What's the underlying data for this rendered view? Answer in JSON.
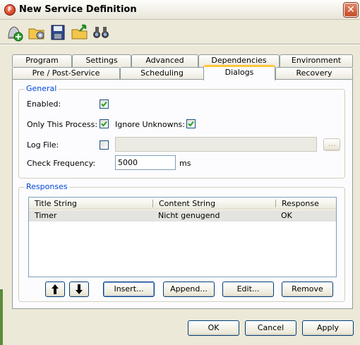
{
  "window": {
    "title": "New Service Definition",
    "close_symbol": "✕",
    "app_icon_letter": "F"
  },
  "toolbar": {
    "buttons": [
      {
        "name": "new-service-icon"
      },
      {
        "name": "open-folder-gear-icon"
      },
      {
        "name": "save-icon"
      },
      {
        "name": "open-folder-icon"
      },
      {
        "name": "find-binoculars-icon"
      }
    ]
  },
  "tabs": {
    "row_back": [
      "Program",
      "Settings",
      "Advanced",
      "Dependencies",
      "Environment"
    ],
    "row_front": [
      "Pre / Post-Service",
      "Scheduling",
      "Dialogs",
      "Recovery"
    ],
    "active": "Dialogs"
  },
  "general": {
    "legend": "General",
    "enabled_label": "Enabled:",
    "enabled_checked": true,
    "only_this_process_label": "Only This Process:",
    "only_this_process_checked": true,
    "ignore_unknowns_label": "Ignore Unknowns:",
    "ignore_unknowns_checked": true,
    "log_file_label": "Log File:",
    "log_file_checked": false,
    "log_file_value": "",
    "browse_label": "...",
    "check_frequency_label": "Check Frequency:",
    "check_frequency_value": "5000",
    "check_frequency_unit": "ms"
  },
  "responses": {
    "legend": "Responses",
    "columns": [
      "Title String",
      "Content String",
      "Response"
    ],
    "rows": [
      {
        "title": "Timer",
        "content": "Nicht genugend",
        "response": "OK"
      }
    ],
    "up_symbol": "🠕",
    "down_symbol": "🠗",
    "insert_label": "Insert...",
    "append_label": "Append...",
    "edit_label": "Edit...",
    "remove_label": "Remove"
  },
  "footer": {
    "ok_label": "OK",
    "cancel_label": "Cancel",
    "apply_label": "Apply"
  }
}
